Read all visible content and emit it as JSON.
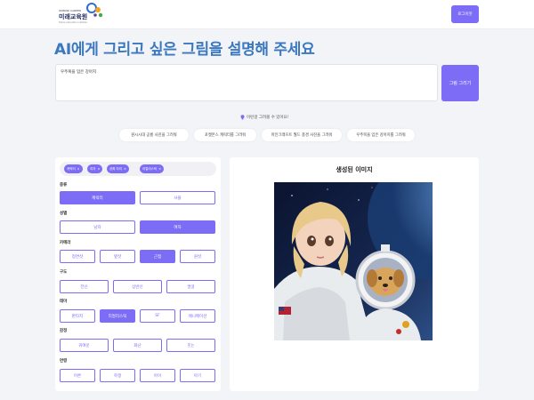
{
  "header": {
    "logo_tagline": "ONNURI CAREER",
    "logo_name": "미래교육원",
    "logo_sub": "future education institute",
    "login_label": "로그이웃"
  },
  "main": {
    "title": "AI에게 그리고 싶은 그림을 설명해 주세요",
    "prompt_value": "우주복을 입은 강아지",
    "draw_label": "그림 그리기",
    "hint": "이런걸 그려볼 수 있어요!"
  },
  "examples": [
    "원시시대 공룡 사진을 그려줘",
    "포켓몬스 캐릭터를 그려줘",
    "마인크래프트 월드 풍경 사진을 그려줘",
    "우주복을 입은 강아지를 그려줘"
  ],
  "tags": [
    "캐릭터",
    "여자",
    "공짜 자리",
    "리얼리스틱"
  ],
  "sections": {
    "type": {
      "label": "종류",
      "options": [
        "캐릭터",
        "사물"
      ]
    },
    "gender": {
      "label": "성별",
      "options": [
        "남자",
        "여자"
      ]
    },
    "angle": {
      "label": "카메라",
      "options": [
        "정면샷",
        "옆샷",
        "근접",
        "원샷"
      ]
    },
    "composition": {
      "label": "구도",
      "options": [
        "전신",
        "상반신",
        "얼굴"
      ]
    },
    "theme": {
      "label": "테마",
      "options": [
        "판타지",
        "리얼리스틱",
        "SF",
        "애니메이션"
      ]
    },
    "emotion": {
      "label": "감정",
      "options": [
        "귀여운",
        "화난",
        "웃는"
      ]
    },
    "age": {
      "label": "연령",
      "options": [
        "어른",
        "학생",
        "아이",
        "아기"
      ]
    }
  },
  "result": {
    "title": "생성된 이미지"
  },
  "colors": {
    "accent": "#7c6cf6",
    "title": "#3a78c0",
    "background": "#f3f4f8"
  }
}
